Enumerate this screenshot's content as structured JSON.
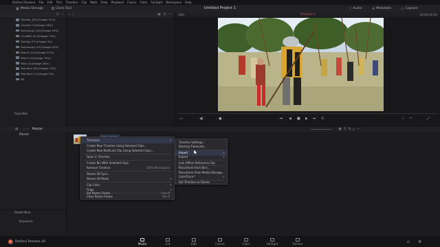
{
  "menubar": [
    "DaVinci Resolve",
    "File",
    "Edit",
    "Trim",
    "Timeline",
    "Clip",
    "Mark",
    "View",
    "Playback",
    "Fusion",
    "Color",
    "Fairlight",
    "Workspace",
    "Help"
  ],
  "toolbar": {
    "media_storage": "Media Storage",
    "clone_tool": "Clone Tool",
    "project_title": "Untitled Project 1",
    "audio": "Audio",
    "metadata": "Metadata",
    "capture": "Capture"
  },
  "drives": [
    "Toshiba_(M1)(Usage 21%)",
    "Chuveh (C)(Usage 16%)",
    "Samsung2 (D1)(Usage 49%)",
    "CruzaBC (E1)(Usage 73%)",
    "Toshiba (F1)(Usage 3%)",
    "Samsung3 (G1)(Usage 40%)",
    "Wdc01 (H1)(Usage 51%)",
    "Wdc4 (I1)(Usage 79%)",
    "Wd4 (J1)(Usage 26%)",
    "Toshiba4 (K1)(Usage 13%)",
    "Toshiba4 (L1)(Usage 3%)",
    "NS"
  ],
  "favorites_label": "Favorites",
  "viewer": {
    "zoom": "28%",
    "timeline_name": "Timeline 1",
    "timecode": "00:00:00:00"
  },
  "pool": {
    "path_label": "Master",
    "master_item": "Master"
  },
  "smart_bins": {
    "label": "Smart Bins",
    "keywords": "Keywords"
  },
  "context_menu": [
    {
      "label": "Timelines",
      "arrow": ">"
    },
    {
      "label": "Create New Timeline Using Selected Clips..."
    },
    {
      "label": "Create New Multicam Clip Using Selected Clips..."
    },
    {
      "label": "Open in Timeline"
    },
    {
      "label": "Create Bin With Selected Clips"
    },
    {
      "label": "Remove Timeline",
      "shortcut": "Shift+Backspace"
    },
    {
      "label": "Stereo 3D Sync..."
    },
    {
      "label": "Stereo 3D Mode",
      "arrow": ">"
    },
    {
      "label": "Clip Color",
      "arrow": ">"
    },
    {
      "label": "Flags",
      "arrow": ">"
    },
    {
      "label": "Set Poster Frame",
      "shortcut": "Ctrl+P"
    },
    {
      "label": "Clear Poster Frame",
      "shortcut": "Alt+P"
    }
  ],
  "submenu": [
    {
      "label": "Timeline Settings..."
    },
    {
      "label": "Starting Timecode..."
    },
    {
      "label": "Import",
      "arrow": ">"
    },
    {
      "label": "Export",
      "arrow": ">"
    },
    {
      "label": "Link Offline Reference Clip"
    },
    {
      "label": "Reconform from Bins..."
    },
    {
      "label": "Reconform From Media Storage..."
    },
    {
      "label": "ColorTrace™",
      "arrow": ">"
    },
    {
      "label": "Set Timeline as Stereo"
    }
  ],
  "app_brand": "DaVinci Resolve 16",
  "pages": [
    "Media",
    "Cut",
    "Edit",
    "Fusion",
    "Color",
    "Fairlight",
    "Deliver"
  ],
  "active_page": "Media"
}
